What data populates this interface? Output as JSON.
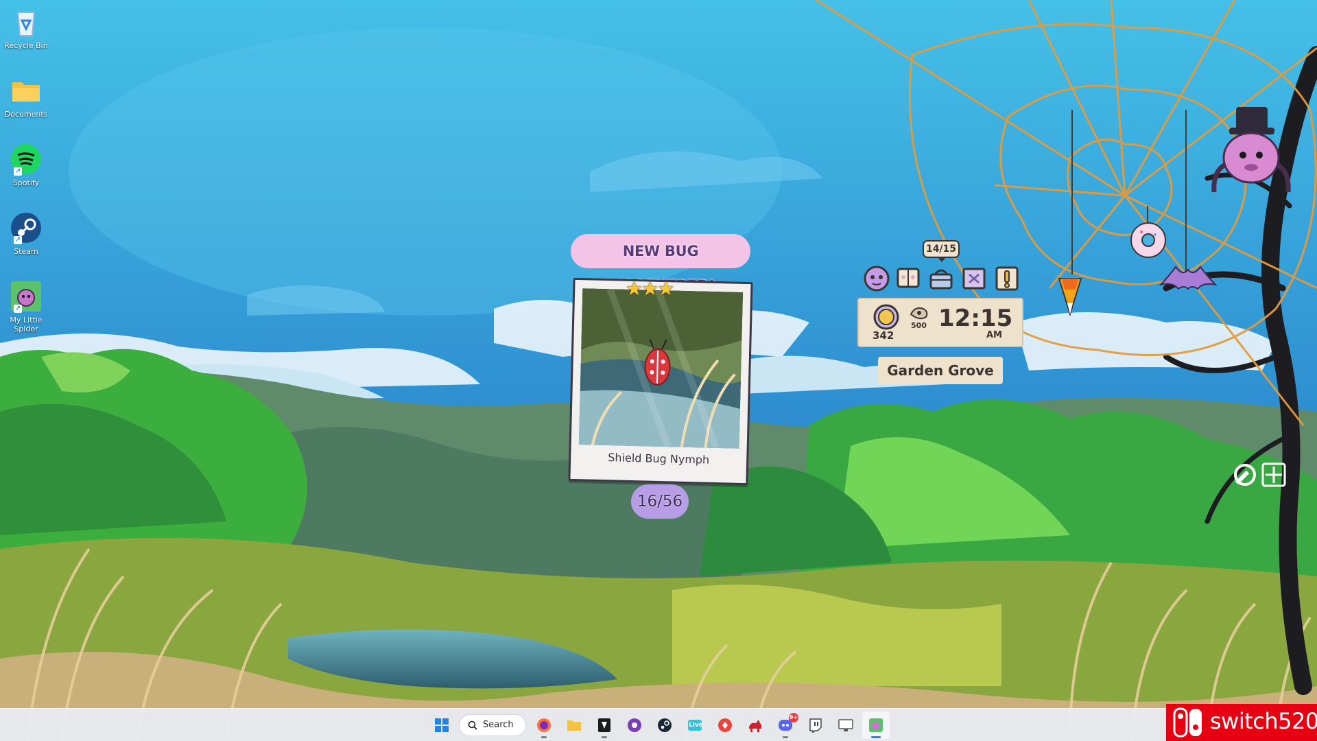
{
  "desktop": {
    "icons": [
      {
        "label": "Recycle Bin",
        "icon": "recycle-bin-icon"
      },
      {
        "label": "Documents",
        "icon": "folder-icon"
      },
      {
        "label": "Spotify",
        "icon": "spotify-icon"
      },
      {
        "label": "Steam",
        "icon": "steam-icon"
      },
      {
        "label": "My Little Spider",
        "icon": "spider-game-icon"
      }
    ]
  },
  "discovery": {
    "banner": "NEW BUG DISCOVERED!",
    "stars": "★★★",
    "star_rating": 3,
    "bug_name": "Shield Bug Nymph",
    "collected": "16/56"
  },
  "widget": {
    "quest_count": "14/15",
    "menu_icons": [
      "spider-face-icon",
      "journal-icon",
      "shop-basket-icon",
      "map-icon",
      "alert-icon"
    ],
    "coins": "342",
    "coin_cap": "500",
    "time": "12:15",
    "ampm": "AM",
    "location": "Garden Grove"
  },
  "taskbar": {
    "search_label": "Search",
    "apps": [
      {
        "name": "firefox",
        "icon": "firefox-icon"
      },
      {
        "name": "file-explorer",
        "icon": "folder-icon"
      },
      {
        "name": "epic-games",
        "icon": "epic-games-icon"
      },
      {
        "name": "obs",
        "icon": "obs-icon"
      },
      {
        "name": "steam",
        "icon": "steam-icon"
      },
      {
        "name": "live",
        "icon": "live-icon",
        "text": "Live"
      },
      {
        "name": "app-red",
        "icon": "red-app-icon"
      },
      {
        "name": "red-animal",
        "icon": "red-animal-icon"
      },
      {
        "name": "discord",
        "icon": "discord-icon",
        "badge": "9+"
      },
      {
        "name": "twitch",
        "icon": "twitch-icon"
      },
      {
        "name": "monitor",
        "icon": "monitor-icon"
      },
      {
        "name": "spider-game",
        "icon": "spider-game-icon"
      }
    ]
  },
  "watermark": "switch520",
  "colors": {
    "sky": "#49b4e4",
    "banner": "#f3c3e8",
    "counter": "#b79ce6",
    "panel": "#efe2cd",
    "taskbar": "#e8ecf4",
    "watermark": "#e60012"
  }
}
